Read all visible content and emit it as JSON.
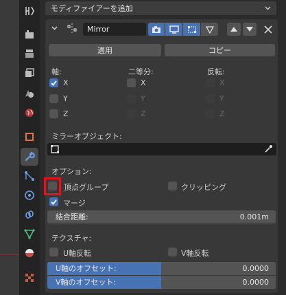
{
  "header": {
    "add_modifier_label": "モディファイアーを追加"
  },
  "modifier": {
    "name": "Mirror",
    "apply_label": "適用",
    "copy_label": "コピー"
  },
  "axes": {
    "axis_heading": "軸:",
    "bisect_heading": "二等分:",
    "flip_heading": "反転:",
    "x": "X",
    "y": "Y",
    "z": "Z"
  },
  "mirror_object": {
    "label": "ミラーオブジェクト:"
  },
  "options": {
    "heading": "オプション:",
    "vertex_groups": "頂点グループ",
    "clipping": "クリッピング",
    "merge": "マージ",
    "merge_distance_label": "結合距離:",
    "merge_distance_value": "0.001m"
  },
  "texture": {
    "heading": "テクスチャ:",
    "flip_u": "U軸反転",
    "flip_v": "V軸反転",
    "u_offset_label": "U軸のオフセット:",
    "u_offset_value": "0.0000",
    "v_offset_label": "V軸のオフセット:",
    "v_offset_value": "0.0000"
  },
  "colors": {
    "accent": "#4772b3",
    "highlight_box": "#e0161e",
    "panel": "#2b2b2b"
  },
  "checkbox_states": {
    "axis_x": true,
    "axis_y": false,
    "axis_z": false,
    "bisect_x": false,
    "bisect_y": false,
    "bisect_z": false,
    "flip_x": false,
    "flip_y": false,
    "flip_z": false,
    "vertex_groups": false,
    "clipping": false,
    "merge": true,
    "flip_u": false,
    "flip_v": false
  }
}
